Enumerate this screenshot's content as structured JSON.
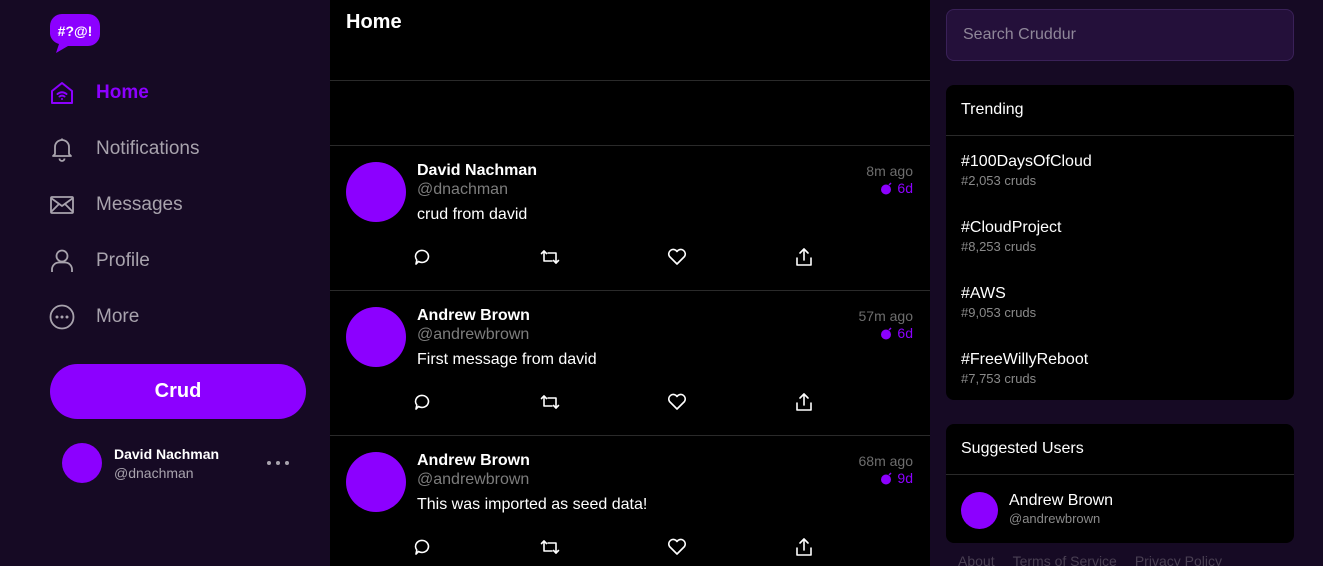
{
  "app": {
    "logo_text": "#?@!",
    "brand_color": "#8c00ff"
  },
  "sidebar": {
    "items": [
      {
        "label": "Home",
        "icon": "home-icon",
        "active": true
      },
      {
        "label": "Notifications",
        "icon": "bell-icon",
        "active": false
      },
      {
        "label": "Messages",
        "icon": "envelope-icon",
        "active": false
      },
      {
        "label": "Profile",
        "icon": "person-icon",
        "active": false
      },
      {
        "label": "More",
        "icon": "more-circle-icon",
        "active": false
      }
    ],
    "crud_button": "Crud",
    "profile": {
      "name": "David Nachman",
      "handle": "@dnachman"
    }
  },
  "feed": {
    "title": "Home",
    "posts": [
      {
        "name": "David Nachman",
        "handle": "@dnachman",
        "message": "crud from david",
        "time_ago": "8m ago",
        "expires": "6d"
      },
      {
        "name": "Andrew Brown",
        "handle": "@andrewbrown",
        "message": "First message from david",
        "time_ago": "57m ago",
        "expires": "6d"
      },
      {
        "name": "Andrew Brown",
        "handle": "@andrewbrown",
        "message": "This was imported as seed data!",
        "time_ago": "68m ago",
        "expires": "9d"
      }
    ]
  },
  "right": {
    "search_placeholder": "Search Cruddur",
    "trending": {
      "title": "Trending",
      "items": [
        {
          "name": "#100DaysOfCloud",
          "count": "#2,053 cruds"
        },
        {
          "name": "#CloudProject",
          "count": "#8,253 cruds"
        },
        {
          "name": "#AWS",
          "count": "#9,053 cruds"
        },
        {
          "name": "#FreeWillyReboot",
          "count": "#7,753 cruds"
        }
      ]
    },
    "suggested": {
      "title": "Suggested Users",
      "users": [
        {
          "name": "Andrew Brown",
          "handle": "@andrewbrown"
        }
      ]
    },
    "footer": [
      "About",
      "Terms of Service",
      "Privacy Policy"
    ]
  }
}
